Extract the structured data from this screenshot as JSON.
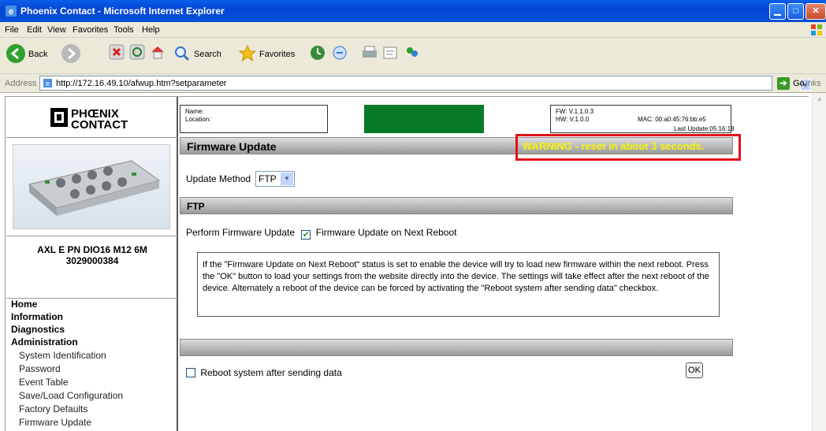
{
  "window": {
    "title": "Phoenix Contact - Microsoft Internet Explorer"
  },
  "menu": [
    "File",
    "Edit",
    "View",
    "Favorites",
    "Tools",
    "Help"
  ],
  "toolbar": {
    "back": "Back",
    "search": "Search",
    "favorites": "Favorites"
  },
  "address": {
    "label": "Address",
    "url": "http://172.16.49.10/afwup.htm?setparameter",
    "go": "Go",
    "links": "Links"
  },
  "logo": {
    "line1": "PHŒNIX",
    "line2": "CONTACT"
  },
  "product": {
    "name": "AXL E PN DIO16 M12 6M",
    "number": "3029000384"
  },
  "nav": {
    "main": [
      "Home",
      "Information",
      "Diagnostics",
      "Administration"
    ],
    "sub": [
      "System Identification",
      "Password",
      "Event Table",
      "Save/Load Configuration",
      "Factory Defaults",
      "Firmware Update"
    ]
  },
  "device_header": {
    "name_label": "Name:",
    "location_label": "Location:",
    "fw": "FW: V.1.1.0.3",
    "hw": "HW: V.1.0.0",
    "mac": "MAC: 00:a0:45:76:bb:e5",
    "last_update": "Last Update:05:16:18"
  },
  "page": {
    "title": "Firmware Update",
    "warning": "WARNING - reset in about 3 seconds.",
    "update_method_label": "Update Method",
    "update_method_value": "FTP",
    "ftp_section": "FTP",
    "perform_label": "Perform Firmware Update",
    "perform_option": "Firmware Update on Next Reboot",
    "notice": "If the \"Firmware Update on Next Reboot\" status is set to enable the device will try to load new firmware within the next reboot. Press the \"OK\" button to load your settings from the website directly into the device. The settings will take effect after the next reboot of the device. Alternately a reboot of the device can be forced by activating the \"Reboot system after sending data\" checkbox.",
    "reboot_label": "Reboot system after sending data",
    "ok_label": "OK"
  },
  "colors": {
    "warning_text": "#f7f40a",
    "warning_border": "#e0101a",
    "status_green": "#077a27",
    "title_bar": "#0a5ee8"
  }
}
